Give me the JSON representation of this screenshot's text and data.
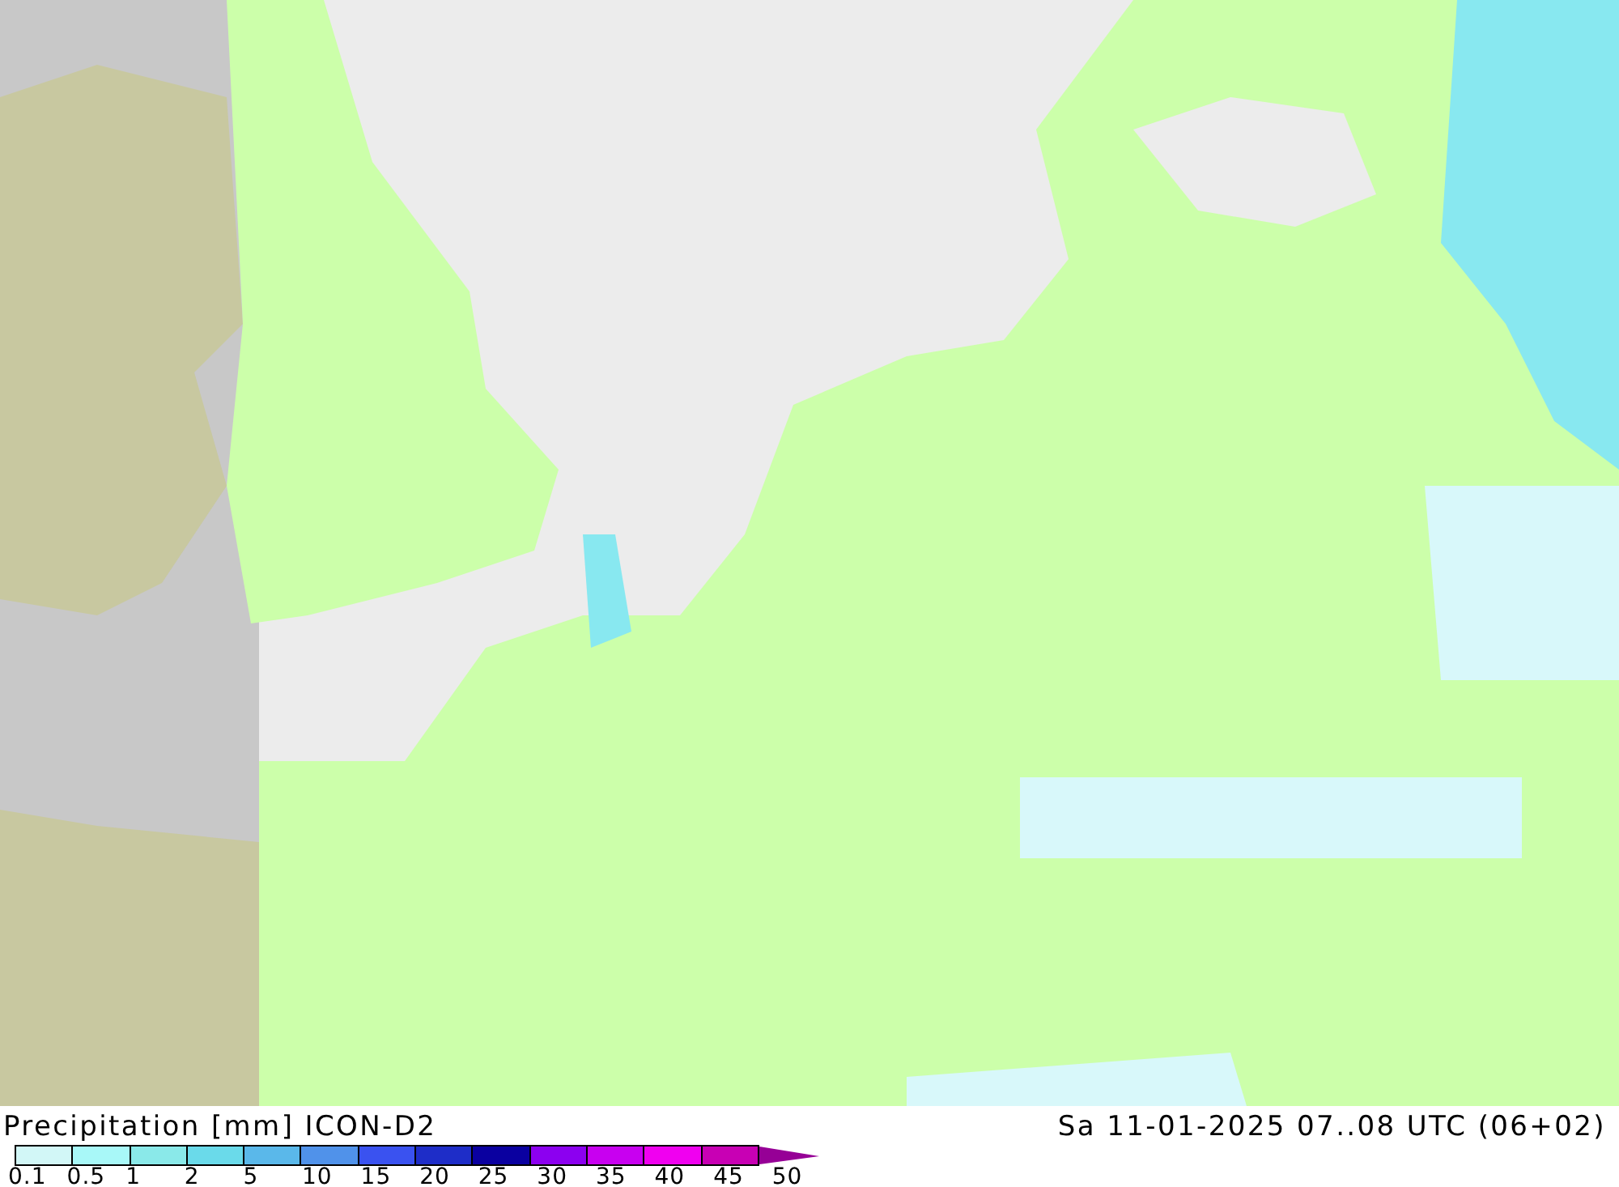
{
  "title": "Precipitation [mm] ICON-D2",
  "valid_time": "Sa 11-01-2025 07..08 UTC (06+02)",
  "legend": {
    "swatches": [
      {
        "color": "#d2f7f7"
      },
      {
        "color": "#a8f8f8"
      },
      {
        "color": "#8ae9e9"
      },
      {
        "color": "#6adaea"
      },
      {
        "color": "#5ab8ea"
      },
      {
        "color": "#5092ea"
      },
      {
        "color": "#3a52f0"
      },
      {
        "color": "#1e2dc8"
      },
      {
        "color": "#0a00a0"
      },
      {
        "color": "#8c00f0"
      },
      {
        "color": "#c800f0"
      },
      {
        "color": "#f000f0"
      },
      {
        "color": "#c800b4"
      }
    ],
    "labels": [
      "0.1",
      "0.5",
      "1",
      "2",
      "5",
      "10",
      "15",
      "20",
      "25",
      "30",
      "35",
      "40",
      "45",
      "50"
    ]
  }
}
